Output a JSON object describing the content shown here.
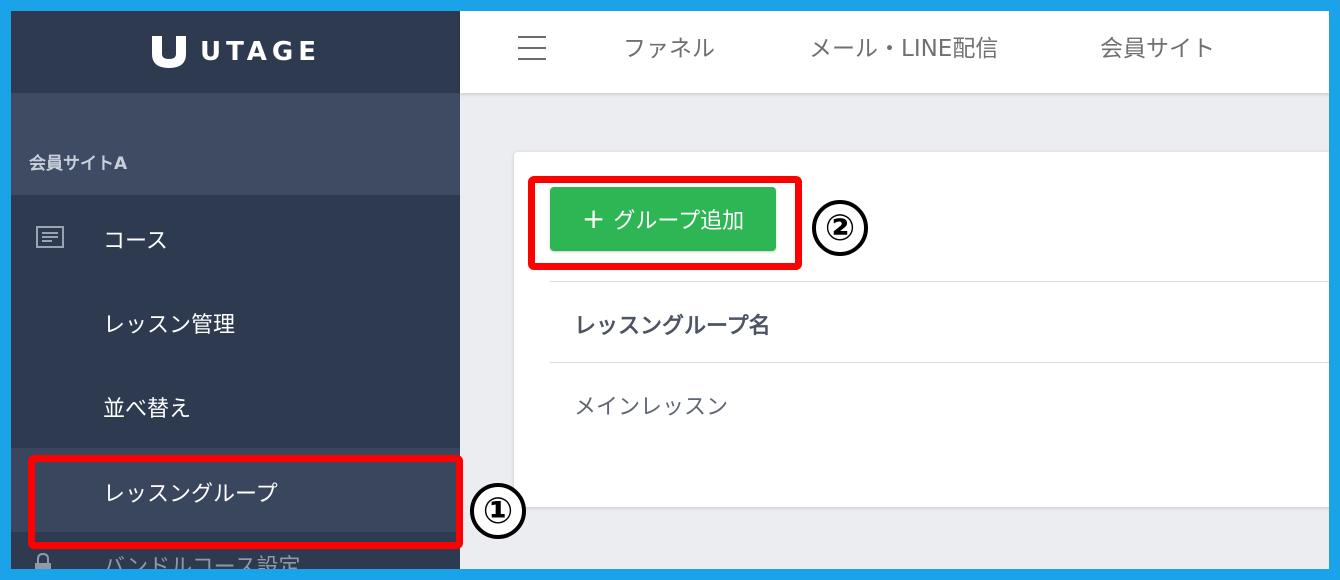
{
  "logo": {
    "text": "UTAGE"
  },
  "topnav": {
    "menu_icon": "hamburger-menu-icon",
    "links": [
      "ファネル",
      "メール・LINE配信",
      "会員サイト"
    ]
  },
  "sidebar": {
    "site_name": "会員サイトA",
    "items": [
      {
        "label": "コース",
        "icon": "document-list-icon"
      },
      {
        "label": "レッスン管理"
      },
      {
        "label": "並べ替え"
      },
      {
        "label": "レッスングループ",
        "active": true
      },
      {
        "label": "バンドルコース設定",
        "icon": "lock-icon"
      }
    ]
  },
  "main": {
    "add_button": {
      "icon": "plus-icon",
      "label": "グループ追加"
    },
    "table": {
      "column_header": "レッスングループ名",
      "rows": [
        "メインレッスン"
      ]
    }
  },
  "annotations": {
    "marker_1": "①",
    "marker_2": "②",
    "highlight_color": "#ff0000"
  },
  "colors": {
    "sidebar_bg": "#2e3a4f",
    "button_green": "#2eb654",
    "frame_blue": "#1aa3e8"
  }
}
